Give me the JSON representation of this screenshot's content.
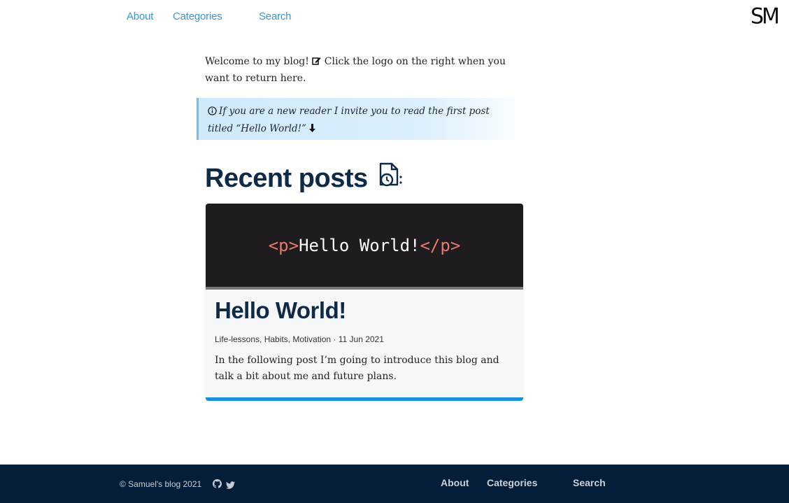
{
  "nav": {
    "about": "About",
    "categories": "Categories",
    "search": "Search"
  },
  "logo": {
    "text": "SM"
  },
  "intro": {
    "part1": "Welcome to my blog! ",
    "part2": " Click the logo on the right when you want to return here.",
    "pen_icon": "edit-pen-icon"
  },
  "callout": {
    "text": "If you are a new reader I invite you to read the first post titled “Hello World!”",
    "info_icon": "info-circle-icon",
    "arrow_icon": "arrow-down-icon"
  },
  "recent_posts": {
    "heading": "Recent posts",
    "icon": "document-clock-icon"
  },
  "post": {
    "image_code_open": "<p>",
    "image_code_text": "Hello World!",
    "image_code_close": "</p>",
    "title": "Hello World!",
    "meta": "Life-lessons, Habits, Motivation · 11 Jun 2021",
    "description": "In the following post I’m going to introduce this blog and talk a bit about me and future plans."
  },
  "footer": {
    "copyright": "© Samuel's blog 2021",
    "github_icon": "github-icon",
    "twitter_icon": "twitter-icon",
    "about": "About",
    "categories": "Categories",
    "search": "Search"
  },
  "colors": {
    "link": "#3b95cf",
    "heading": "#0f2a47",
    "footer_bg": "#041e3a",
    "accent_bar": "#1b8fd2",
    "code_tag": "#e9786f"
  }
}
